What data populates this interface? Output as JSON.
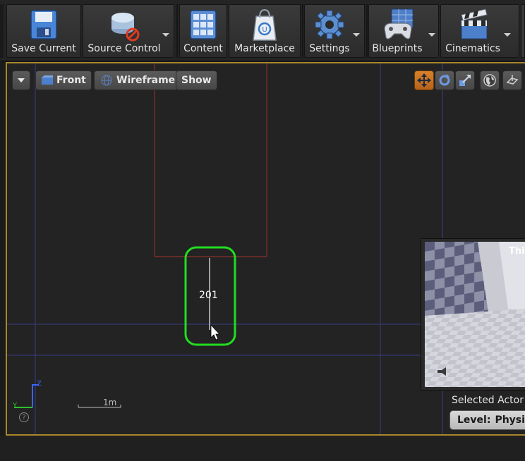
{
  "toolbar": {
    "save_label": "Save Current",
    "source_control_label": "Source Control",
    "content_label": "Content",
    "marketplace_label": "Marketplace",
    "settings_label": "Settings",
    "blueprints_label": "Blueprints",
    "cinematics_label": "Cinematics"
  },
  "viewport": {
    "view_mode": "Front",
    "render_mode": "Wireframe",
    "show_label": "Show",
    "measure_value": "201",
    "scale_label": "1m",
    "selection_color": "#22dd22",
    "border_color": "#a8862a"
  },
  "preview": {
    "title": "Thir",
    "selected_actor_label": "Selected Actor",
    "level_label": "Level:",
    "level_value": "Physic"
  },
  "icons": {
    "save": "floppy-disk-icon",
    "source_control": "source-control-icon",
    "content": "content-browser-icon",
    "marketplace": "marketplace-bag-icon",
    "settings": "gear-icon",
    "blueprints": "gamepad-icon",
    "cinematics": "clapperboard-icon"
  }
}
